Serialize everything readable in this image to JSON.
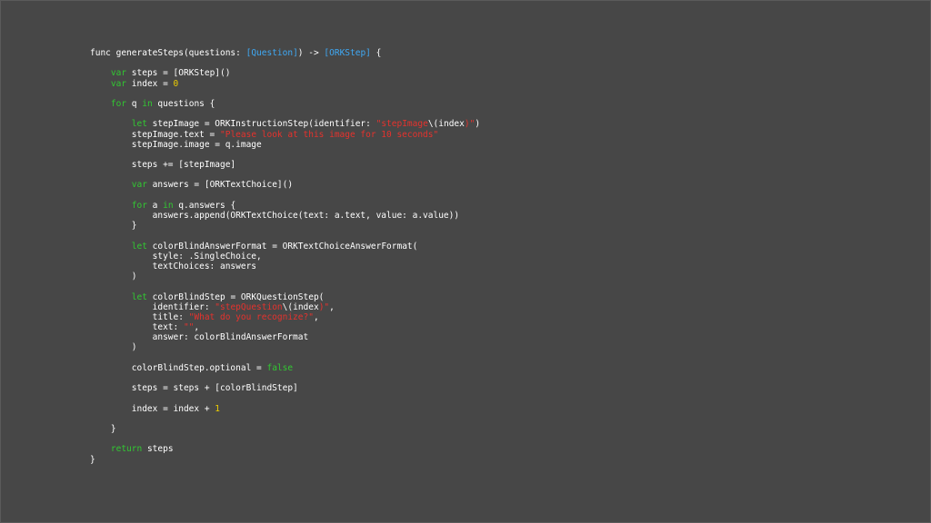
{
  "colors": {
    "background": "#474747",
    "plain": "#ffffff",
    "keyword": "#32c832",
    "type": "#3fa9f5",
    "string": "#e6322d",
    "number": "#f0d000"
  },
  "code": {
    "lines": [
      [
        [
          "pln",
          "func generateSteps(questions: "
        ],
        [
          "type",
          "[Question]"
        ],
        [
          "pln",
          ") -> "
        ],
        [
          "type",
          "[ORKStep]"
        ],
        [
          "pln",
          " {"
        ]
      ],
      [],
      [
        [
          "pln",
          "    "
        ],
        [
          "kw",
          "var"
        ],
        [
          "pln",
          " steps = [ORKStep]()"
        ]
      ],
      [
        [
          "pln",
          "    "
        ],
        [
          "kw",
          "var"
        ],
        [
          "pln",
          " index = "
        ],
        [
          "num",
          "0"
        ]
      ],
      [],
      [
        [
          "pln",
          "    "
        ],
        [
          "kw",
          "for"
        ],
        [
          "pln",
          " q "
        ],
        [
          "kw",
          "in"
        ],
        [
          "pln",
          " questions {"
        ]
      ],
      [],
      [
        [
          "pln",
          "        "
        ],
        [
          "kw",
          "let"
        ],
        [
          "pln",
          " stepImage = ORKInstructionStep(identifier: "
        ],
        [
          "str",
          "\"stepImage"
        ],
        [
          "pln",
          "\\("
        ],
        [
          "pln",
          "index"
        ],
        [
          "str",
          ")\""
        ],
        [
          "pln",
          ")"
        ]
      ],
      [
        [
          "pln",
          "        stepImage.text = "
        ],
        [
          "str",
          "\"Please look at this image for 10 seconds\""
        ]
      ],
      [
        [
          "pln",
          "        stepImage.image = q.image"
        ]
      ],
      [],
      [
        [
          "pln",
          "        steps += [stepImage]"
        ]
      ],
      [],
      [
        [
          "pln",
          "        "
        ],
        [
          "kw",
          "var"
        ],
        [
          "pln",
          " answers = [ORKTextChoice]()"
        ]
      ],
      [],
      [
        [
          "pln",
          "        "
        ],
        [
          "kw",
          "for"
        ],
        [
          "pln",
          " a "
        ],
        [
          "kw",
          "in"
        ],
        [
          "pln",
          " q.answers {"
        ]
      ],
      [
        [
          "pln",
          "            answers.append(ORKTextChoice(text: a.text, value: a.value))"
        ]
      ],
      [
        [
          "pln",
          "        }"
        ]
      ],
      [],
      [
        [
          "pln",
          "        "
        ],
        [
          "kw",
          "let"
        ],
        [
          "pln",
          " colorBlindAnswerFormat = ORKTextChoiceAnswerFormat("
        ]
      ],
      [
        [
          "pln",
          "            style: .SingleChoice,"
        ]
      ],
      [
        [
          "pln",
          "            textChoices: answers"
        ]
      ],
      [
        [
          "pln",
          "        )"
        ]
      ],
      [],
      [
        [
          "pln",
          "        "
        ],
        [
          "kw",
          "let"
        ],
        [
          "pln",
          " colorBlindStep = ORKQuestionStep("
        ]
      ],
      [
        [
          "pln",
          "            identifier: "
        ],
        [
          "str",
          "\"stepQuestion"
        ],
        [
          "pln",
          "\\("
        ],
        [
          "pln",
          "index"
        ],
        [
          "str",
          ")\""
        ],
        [
          "pln",
          ","
        ]
      ],
      [
        [
          "pln",
          "            title: "
        ],
        [
          "str",
          "\"What do you recognize?\""
        ],
        [
          "pln",
          ","
        ]
      ],
      [
        [
          "pln",
          "            text: "
        ],
        [
          "str",
          "\"\""
        ],
        [
          "pln",
          ","
        ]
      ],
      [
        [
          "pln",
          "            answer: colorBlindAnswerFormat"
        ]
      ],
      [
        [
          "pln",
          "        )"
        ]
      ],
      [],
      [
        [
          "pln",
          "        colorBlindStep.optional = "
        ],
        [
          "kw",
          "false"
        ]
      ],
      [],
      [
        [
          "pln",
          "        steps = steps + [colorBlindStep]"
        ]
      ],
      [],
      [
        [
          "pln",
          "        index = index + "
        ],
        [
          "num",
          "1"
        ]
      ],
      [],
      [
        [
          "pln",
          "    }"
        ]
      ],
      [],
      [
        [
          "pln",
          "    "
        ],
        [
          "kw",
          "return"
        ],
        [
          "pln",
          " steps"
        ]
      ],
      [
        [
          "pln",
          "}"
        ]
      ]
    ]
  }
}
